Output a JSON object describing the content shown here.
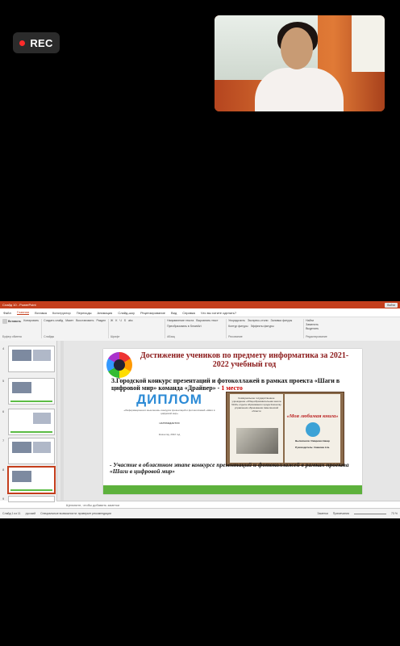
{
  "recording": {
    "label": "REC"
  },
  "app": {
    "window_title": "Слайд 10 - PowerPoint",
    "account_button": "Войти",
    "tabs": [
      "Файл",
      "Главная",
      "Вставка",
      "Конструктор",
      "Переходы",
      "Анимация",
      "Слайд-шоу",
      "Рецензирование",
      "Вид",
      "Справка",
      "Что вы хотите сделать?"
    ],
    "ribbon": {
      "clipboard": {
        "group": "Буфер обмена",
        "items": [
          "Вставить",
          "Копировать"
        ]
      },
      "slides": {
        "group": "Слайды",
        "items": [
          "Создать слайд",
          "Макет",
          "Восстановить",
          "Раздел"
        ]
      },
      "font": {
        "group": "Шрифт",
        "items": [
          "Ж",
          "К",
          "Ч",
          "S",
          "abc"
        ]
      },
      "paragraph": {
        "group": "Абзац",
        "items": [
          "Направление текста",
          "Выровнять текст",
          "Преобразовать в SmartArt"
        ]
      },
      "drawing": {
        "group": "Рисование",
        "items": [
          "Упорядочить",
          "Экспресс-стили",
          "Заливка фигуры",
          "Контур фигуры",
          "Эффекты фигуры"
        ]
      },
      "editing": {
        "group": "Редактирование",
        "items": [
          "Найти",
          "Заменить",
          "Выделить"
        ]
      }
    },
    "thumbs": [
      "4",
      "5",
      "6",
      "7",
      "8",
      "9"
    ],
    "notes_placeholder": "Щелкните, чтобы добавить заметки",
    "status": {
      "slide_counter": "Слайд 1 из 11",
      "language": "русский",
      "accessibility": "Специальные возможности: проверьте рекомендации",
      "notes": "Заметки",
      "comments": "Примечания",
      "zoom": "73 %"
    }
  },
  "slide": {
    "title": "Достижение учеников по предмету информатика за 2021-2022 учебный год",
    "subtitle_main": "3.Городской конкурс презентаций и фотоколлажей в рамках проекта «Шаги в цифровой мир» команда «Драйвер» -",
    "subtitle_place": "1 место",
    "diploma_title": "ДИПЛОМ",
    "diploma_text": "«Информационного мышления» конкурса презентаций и фотоколлажей «Шаги в цифровой мир»",
    "diploma_award": "НАГРАЖДАЕТСЯ",
    "diploma_year": "Кокшетау, 2022 год",
    "book_left": "Коммунальное государственное учреждение «Общеобразовательная школа №10» отдела образования города Кокшетау управления образования Акмолинской области",
    "book_title": "«Моя любимая книга»",
    "book_author": "Выполнила: Омарова Нинар",
    "book_supervisor": "Руководитель: Смакова А.Б.",
    "note": "- Участие в областном этапе конкурсе презентаций и фотоколлажей в рамках проекта «Шаги в цифровой мир»"
  }
}
